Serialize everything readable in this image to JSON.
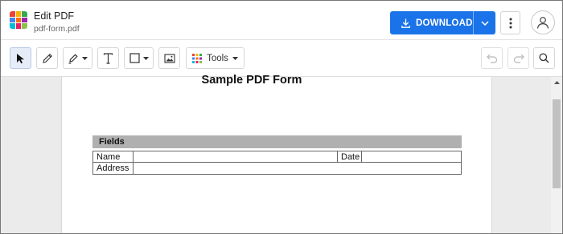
{
  "header": {
    "title": "Edit PDF",
    "filename": "pdf-form.pdf",
    "download_label": "DOWNLOAD"
  },
  "toolbar": {
    "tools_label": "Tools"
  },
  "document": {
    "title": "Sample PDF Form",
    "section_header": "Fields",
    "rows": [
      {
        "label": "Name",
        "secondary_label": "Date"
      },
      {
        "label": "Address"
      }
    ]
  },
  "colors": {
    "accent": "#1a73e8",
    "logo": [
      "#f4b400",
      "#ea4335",
      "#34a853",
      "#4285f4",
      "#ff6d00",
      "#9c27b0",
      "#00bcd4",
      "#e91e63",
      "#8bc34a"
    ]
  },
  "icons": [
    "app-logo-icon",
    "download-icon",
    "chevron-down-icon",
    "more-vertical-icon",
    "user-icon",
    "cursor-icon",
    "pencil-icon",
    "highlighter-icon",
    "text-icon",
    "rectangle-icon",
    "image-icon",
    "tools-grid-icon",
    "undo-icon",
    "redo-icon",
    "search-icon"
  ]
}
